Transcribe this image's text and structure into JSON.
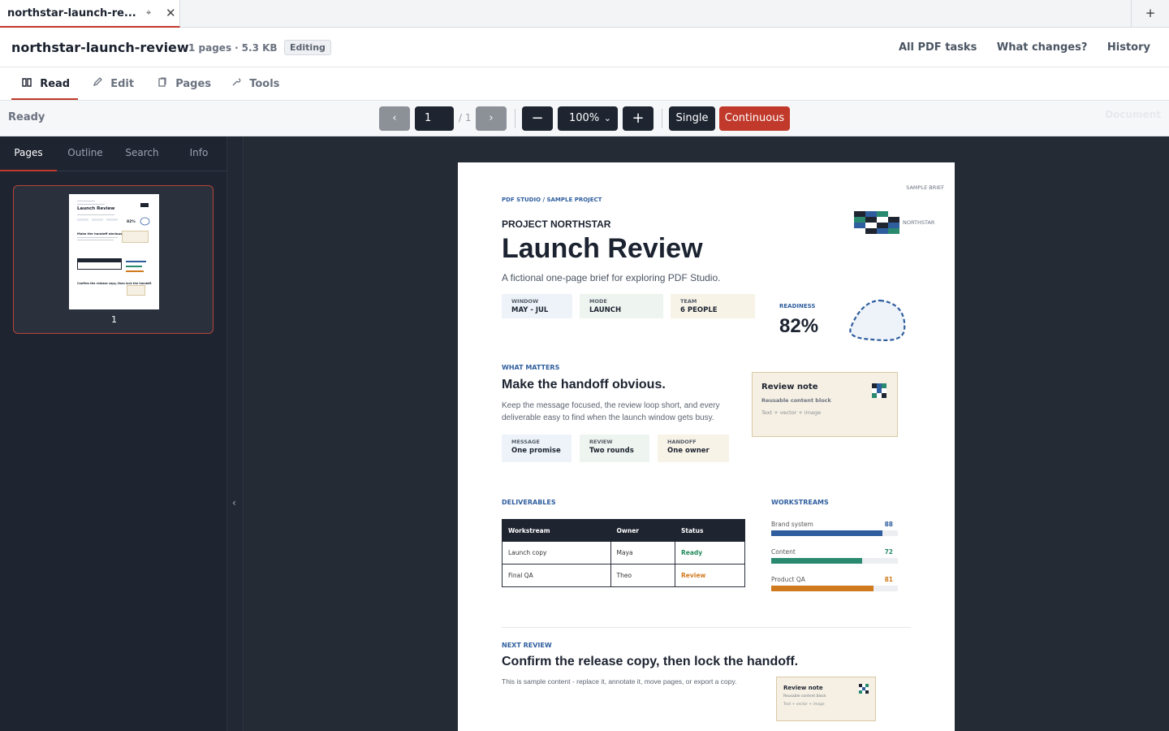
{
  "tab": {
    "title": "northstar-launch-re...",
    "pin_icon": "pin-icon",
    "close_icon": "close-icon"
  },
  "newtab": {
    "label": "+"
  },
  "header": {
    "title": "northstar-launch-review",
    "pages": "1 pages",
    "size": "5.3 KB",
    "badge": "Editing",
    "links": [
      "All PDF tasks",
      "What changes?",
      "History"
    ]
  },
  "modes": [
    {
      "label": "Read",
      "icon": "book-icon"
    },
    {
      "label": "Edit",
      "icon": "pencil-icon"
    },
    {
      "label": "Pages",
      "icon": "pages-icon"
    },
    {
      "label": "Tools",
      "icon": "tools-icon"
    }
  ],
  "toolbar": {
    "status": "Ready",
    "page_value": "1",
    "page_total": "/ 1",
    "zoom": "100%",
    "single_label": "Single",
    "continuous_label": "Continuous",
    "faded_label": "Document"
  },
  "sidebar": {
    "tabs": [
      "Pages",
      "Outline",
      "Search",
      "Info"
    ],
    "thumb_number": "1",
    "thumb_title": "Launch Review",
    "thumb_pct": "82%",
    "thumb_heading": "Make the handoff obvious.",
    "thumb_footer_heading": "Confirm the release copy, then lock the handoff."
  },
  "page": {
    "corner": "SAMPLE BRIEF",
    "kicker": "PDF STUDIO / SAMPLE PROJECT",
    "project": "PROJECT NORTHSTAR",
    "title": "Launch Review",
    "subtitle": "A fictional one-page brief for exploring PDF Studio.",
    "logo_label": "NORTHSTAR",
    "stats": [
      {
        "key": "WINDOW",
        "value": "MAY - JUL",
        "color": "#eef3fa"
      },
      {
        "key": "MODE",
        "value": "LAUNCH",
        "color": "#eef4ef"
      },
      {
        "key": "TEAM",
        "value": "6 PEOPLE",
        "color": "#f8f3e7"
      }
    ],
    "readiness_label": "READINESS",
    "readiness_value": "82%",
    "matters_kicker": "WHAT MATTERS",
    "matters_heading": "Make the handoff obvious.",
    "matters_body_1": "Keep the message focused, the review loop short, and every",
    "matters_body_2": "deliverable easy to find when the launch window gets busy.",
    "pills": [
      {
        "key": "MESSAGE",
        "value": "One promise",
        "color": "#eef3fa"
      },
      {
        "key": "REVIEW",
        "value": "Two rounds",
        "color": "#eef4ef"
      },
      {
        "key": "HANDOFF",
        "value": "One owner",
        "color": "#f8f3e7"
      }
    ],
    "note": {
      "title": "Review note",
      "sub": "Reusable content block",
      "meta": "Text + vector + image"
    },
    "deliverables_kicker": "DELIVERABLES",
    "table": {
      "headers": [
        "Workstream",
        "Owner",
        "Status"
      ],
      "rows": [
        {
          "workstream": "Launch copy",
          "owner": "Maya",
          "status": "Ready",
          "status_color": "#1f8a5b"
        },
        {
          "workstream": "Final QA",
          "owner": "Theo",
          "status": "Review",
          "status_color": "#d07a1e"
        }
      ]
    },
    "workstreams_kicker": "WORKSTREAMS",
    "workstreams": [
      {
        "label": "Brand system",
        "value": 88,
        "color": "#2f5e9e"
      },
      {
        "label": "Content",
        "value": 72,
        "color": "#2a8a6f"
      },
      {
        "label": "Product QA",
        "value": 81,
        "color": "#d07a1e"
      }
    ],
    "next_kicker": "NEXT REVIEW",
    "next_heading": "Confirm the release copy, then lock the handoff.",
    "next_body": "This is sample content - replace it, annotate it, move pages, or export a copy.",
    "note2": {
      "title": "Review note",
      "sub": "Reusable content block",
      "meta": "Text + vector + image"
    }
  },
  "colors": {
    "accent": "#c0392b",
    "dark": "#1e2430",
    "blue": "#2f5e9e"
  }
}
